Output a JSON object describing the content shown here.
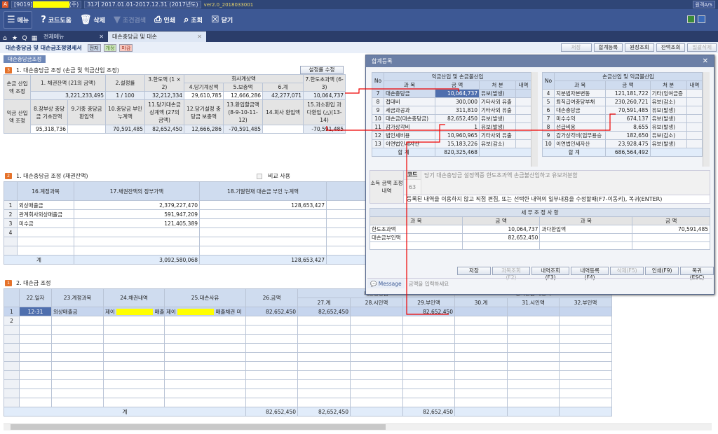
{
  "titlebar": {
    "app_icon": "A",
    "company_code": "[9019]",
    "company_suffix": "(주)",
    "period": "31기 2017.01.01-2017.12.31 (2017년도)",
    "version": "ver2.0_2018033001",
    "remote_as": "원격A/S"
  },
  "toolbar": {
    "menu": "메뉴",
    "code_help": "코드도움",
    "delete": "삭제",
    "filter": "조건검색",
    "print": "인쇄",
    "search": "조회",
    "close": "닫기"
  },
  "tabs": {
    "all_menu": "전체메뉴",
    "active": "대손충당금 및 대손"
  },
  "page": {
    "title": "대손충당금 및 대손금조정명세서",
    "badges": [
      "전자",
      "개정",
      "마감"
    ],
    "buttons": [
      "저장",
      "합계등록",
      "원장조회",
      "잔액조회",
      "일괄삭제"
    ],
    "section_label": "대손충당금조정"
  },
  "section1": {
    "num": "3",
    "title": "1. 대손충당금 조정 (손금 및 익금산입 조정)",
    "edit_rate": "설정률 수정",
    "row1_label": "손금 산입액 조정",
    "row2_label": "익금 산입액 조정",
    "h": [
      "1. 채권잔액 (21의 금액)",
      "2.설정률",
      "3.한도액 (1 × 2)",
      "회사계상액",
      "4.당기계상액",
      "5.보충액",
      "6.계",
      "7.한도초과액 (6-3)"
    ],
    "v": [
      "3,221,233,495",
      "1 / 100",
      "32,212,334",
      "29,610,785",
      "12,666,286",
      "42,277,071",
      "10,064,737"
    ],
    "h2": [
      "8.장부상 충당금 기초잔액",
      "9.기중 충당금 환입액",
      "10.충당금 부인 누계액",
      "11.당기대손금 상계액 (27의 금액)",
      "12.당기설정 충당금 보충액",
      "13.환입할금액 (8-9-10-11-12)",
      "14.회사 환입액",
      "15.과소환입 과다환입 (△)(13-14)"
    ],
    "v2": [
      "95,318,736",
      "",
      "70,591,485",
      "82,652,450",
      "12,666,286",
      "-70,591,485",
      "",
      "-70,591,485"
    ]
  },
  "section2": {
    "num": "2",
    "title": "1. 대손충당금 조정 (채권잔액)",
    "compare": "비교 사용",
    "headers": [
      "16.계정과목",
      "17.채권잔액의 장부가액",
      "18.기말현재 대손금 부인 누계액"
    ],
    "rows": [
      {
        "no": "1",
        "a": "외상매출금",
        "b": "2,379,227,470",
        "c": "128,653,427"
      },
      {
        "no": "2",
        "a": "관계회사외상매출금",
        "b": "591,947,209",
        "c": ""
      },
      {
        "no": "3",
        "a": "미수금",
        "b": "121,405,389",
        "c": ""
      },
      {
        "no": "4",
        "a": "",
        "b": "",
        "c": ""
      },
      {
        "no": "",
        "a": "",
        "b": "",
        "c": ""
      },
      {
        "no": "",
        "a": "",
        "b": "",
        "c": ""
      }
    ],
    "total_label": "계",
    "total_b": "3,092,580,068",
    "total_c": "128,653,427"
  },
  "section3": {
    "num": "1",
    "title": "2. 대손금 조정",
    "headers": [
      "22.일자",
      "23.계정과목",
      "24.채권내역",
      "25.대손사유",
      "26.금액",
      "대손충당금",
      "27.계",
      "28.시인액",
      "29.부인액",
      "당기손금 계상액",
      "30.계",
      "31.시인액",
      "32.부인액"
    ],
    "row1": {
      "no": "1",
      "date": "12-31",
      "account": "외상매출금",
      "bond_prefix": "제이",
      "bond_suffix": "매출",
      "reason_prefix": "제이",
      "reason_suffix": "매출채권 미",
      "amount": "82,652,450",
      "c27": "82,652,450",
      "c28": "",
      "c29": "82,652,450",
      "c30": "",
      "c31": "",
      "c32": ""
    },
    "row2_no": "2",
    "total_label": "계",
    "totals": [
      "82,652,450",
      "82,652,450",
      "",
      "82,652,450",
      "",
      "",
      ""
    ]
  },
  "dialog": {
    "title": "합계등록",
    "left": {
      "title": "익금산입 및 손금불산입",
      "cols": [
        "No",
        "과  목",
        "금  액",
        "처  분",
        "내역"
      ],
      "rows": [
        [
          "7",
          "대손충당금",
          "10,064,737",
          "유보(발생)"
        ],
        [
          "8",
          "접대비",
          "300,000",
          "기타사외 유출"
        ],
        [
          "9",
          "세금과공과",
          "311,810",
          "기타사외 유출"
        ],
        [
          "10",
          "대손금(대손충당금)",
          "82,652,450",
          "유보(발생)"
        ],
        [
          "11",
          "감가상각비",
          "1",
          "유보(발생)"
        ],
        [
          "12",
          "법인세비용",
          "10,960,965",
          "기타사외 유출"
        ],
        [
          "13",
          "이연법인세자산",
          "15,183,226",
          "유보(감소)"
        ]
      ],
      "total_label": "합 계",
      "total": "820,325,468"
    },
    "right": {
      "title": "손금산입 및 익금불산입",
      "cols": [
        "No",
        "과  목",
        "금  액",
        "처  분",
        "내역"
      ],
      "rows": [
        [
          "4",
          "지분법자본변동",
          "121,181,722",
          "기타(잉여금증"
        ],
        [
          "5",
          "퇴직급여충당부채",
          "230,260,721",
          "유보(감소)"
        ],
        [
          "6",
          "대손충당금",
          "70,591,485",
          "유보(발생)"
        ],
        [
          "7",
          "미수수익",
          "674,137",
          "유보(발생)"
        ],
        [
          "8",
          "선급비용",
          "8,655",
          "유보(발생)"
        ],
        [
          "9",
          "감가상각비(업무용승",
          "182,650",
          "유보(감소)"
        ],
        [
          "10",
          "이연법인세자산",
          "23,928,475",
          "유보(발생)"
        ]
      ],
      "total_label": "합 계",
      "total": "686,564,492"
    },
    "code_section": {
      "label": "소득 금액 조정 내역",
      "code_header": "코드",
      "code": "63",
      "description": "당기 대손충당금 설정액중 한도초과액 손금불산입하고 유보처분함",
      "hint": "등록된 내역을 이용하지 않고 직접 편집, 또는 선택한 내역의 일부내용을 수정할때(F7-이동키), 복귀(ENTER)"
    },
    "adjustments": {
      "title": "세 무 조 정 사 항",
      "cols": [
        "과    목",
        "금    액",
        "과    목",
        "금    액"
      ],
      "rows": [
        [
          "한도초과액",
          "10,064,737",
          "과다환입액",
          "70,591,485"
        ],
        [
          "대손금부인액",
          "82,652,450",
          "",
          ""
        ],
        [
          "",
          "",
          "",
          ""
        ]
      ]
    },
    "buttons": [
      "저장",
      "과목조회(F2)",
      "내역조회(F3)",
      "내역등록(F4)",
      "삭제(F5)",
      "인쇄(F9)",
      "복귀 (ESC)"
    ],
    "message_label": "Message",
    "message": "금액을 입력하세요"
  }
}
